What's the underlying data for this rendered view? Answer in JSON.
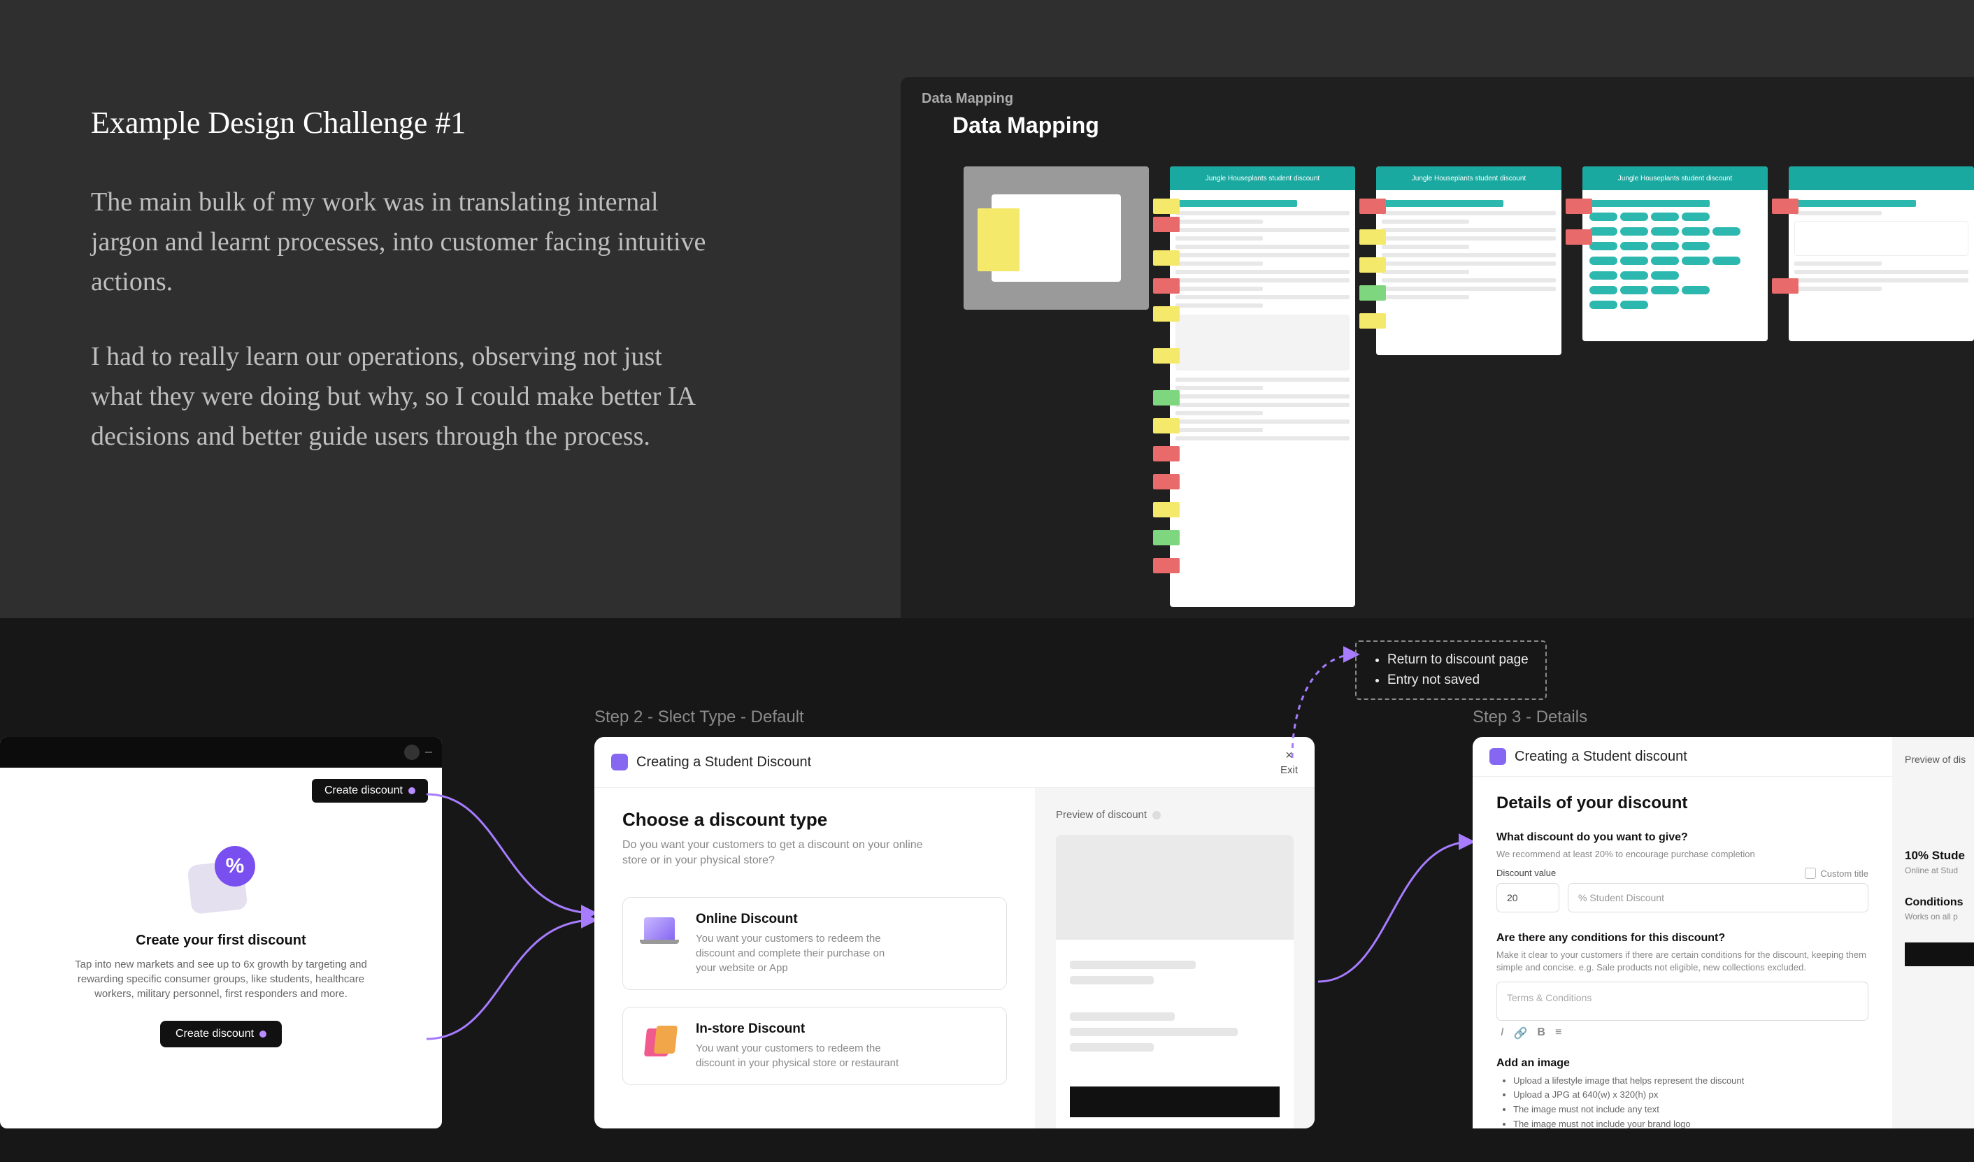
{
  "intro": {
    "title": "Example Design Challenge #1",
    "p1": "The main bulk of my work was in translating internal jargon and learnt processes, into customer facing intuitive actions.",
    "p2": "I had to really learn our operations, observing not just what they were doing but why, so I could make better IA decisions and better guide users through the process."
  },
  "mapping": {
    "breadcrumb": "Data Mapping",
    "title": "Data Mapping",
    "thumb_title": "Jungle Houseplants student discount"
  },
  "callout": {
    "line1": "Return to discount page",
    "line2": "Entry not saved"
  },
  "steps": {
    "s2_label": "Step 2 - Slect Type - Default",
    "s3_label": "Step 3 - Details"
  },
  "step1": {
    "pill": "Create discount",
    "heading": "Create your first discount",
    "blurb": "Tap into new markets and see up to 6x growth by targeting and rewarding specific consumer groups, like students, healthcare workers, military personnel, first responders and more.",
    "cta": "Create discount",
    "pct": "%"
  },
  "step2": {
    "header": "Creating a Student Discount",
    "exit": "Exit",
    "heading": "Choose a discount type",
    "sub": "Do you want your customers to get a discount on your online store or in your physical store?",
    "opt1_title": "Online Discount",
    "opt1_body": "You want your customers to redeem the discount and complete their purchase on your website or App",
    "opt2_title": "In-store Discount",
    "opt2_body": "You want your customers to redeem the discount in your physical store or restaurant",
    "preview_label": "Preview of discount"
  },
  "step3": {
    "header": "Creating a Student discount",
    "heading": "Details of your discount",
    "q1": "What discount do you want to give?",
    "hint1": "We recommend at least 20% to encourage purchase completion",
    "label_value": "Discount value",
    "label_custom": "Custom title",
    "value": "20",
    "value_suffix": "% Student Discount",
    "q2": "Are there any conditions for this discount?",
    "hint2": "Make it clear to your customers if there are certain conditions for the discount, keeping them simple and concise. e.g. Sale products not eligible, new collections excluded.",
    "ta_placeholder": "Terms & Conditions",
    "q3": "Add an image",
    "bul1": "Upload a lifestyle image that helps represent the discount",
    "bul2": "Upload a JPG at 640(w) x 320(h) px",
    "bul3": "The image must not include any text",
    "bul4": "The image must not include your brand logo",
    "preview_label": "Preview of dis",
    "pv_title": "10% Stude",
    "pv_sub": "Online at Stud",
    "pv_cond": "Conditions",
    "pv_cond_sub": "Works on all p",
    "tool_i": "I",
    "tool_link": "🔗",
    "tool_b": "B",
    "tool_list": "≡"
  }
}
